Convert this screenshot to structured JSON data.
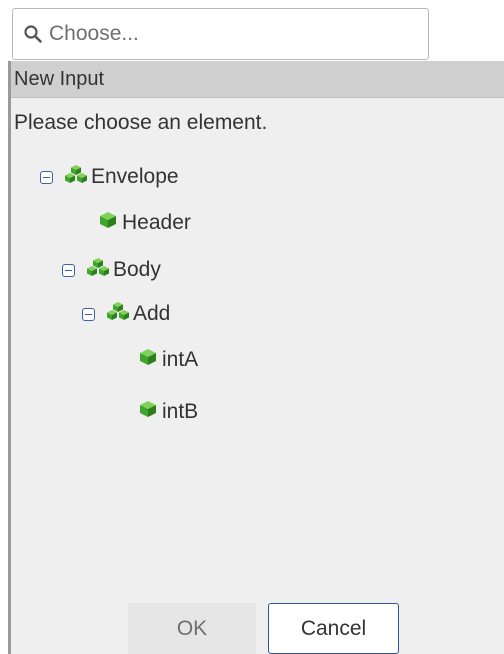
{
  "search": {
    "placeholder": "Choose..."
  },
  "dialog": {
    "title": "New Input",
    "message": "Please choose an element.",
    "tree": [
      {
        "label": "Envelope",
        "icon": "element-group-icon",
        "expanded": true
      },
      {
        "label": "Header",
        "icon": "element-icon"
      },
      {
        "label": "Body",
        "icon": "element-group-icon",
        "expanded": true
      },
      {
        "label": "Add",
        "icon": "element-group-icon",
        "expanded": true
      },
      {
        "label": "intA",
        "icon": "element-icon"
      },
      {
        "label": "intB",
        "icon": "element-icon"
      }
    ],
    "buttons": {
      "ok": "OK",
      "cancel": "Cancel"
    }
  },
  "colors": {
    "icon_green": "#3fa52c",
    "toggle_blue": "#3b62a8",
    "title_bar": "#cfcfcf",
    "panel": "#efefef"
  }
}
